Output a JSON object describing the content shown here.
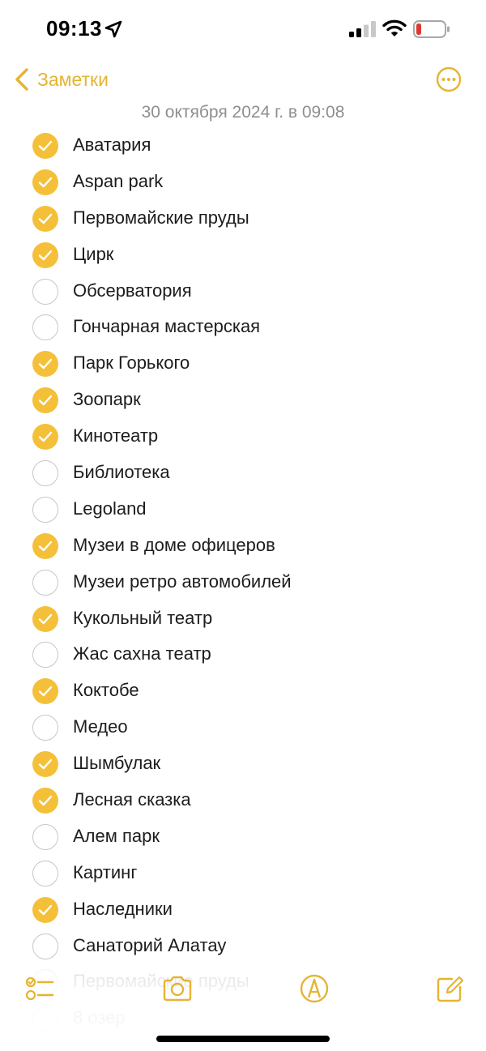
{
  "status_bar": {
    "time": "09:13",
    "icons": [
      "location-arrow-icon",
      "cellular-signal-icon",
      "wifi-icon",
      "battery-low-icon"
    ],
    "battery_color": "#e0382f"
  },
  "nav": {
    "back_label": "Заметки",
    "back_icon": "chevron-left-icon",
    "more_icon": "ellipsis-circle-icon"
  },
  "note": {
    "date": "30 октября 2024 г. в 09:08"
  },
  "accent_color": "#F5C039",
  "checklist": [
    {
      "label": "Аватария",
      "checked": true
    },
    {
      "label": "Aspan park",
      "checked": true
    },
    {
      "label": "Первомайские пруды",
      "checked": true
    },
    {
      "label": "Цирк",
      "checked": true
    },
    {
      "label": "Обсерватория",
      "checked": false
    },
    {
      "label": "Гончарная мастерская",
      "checked": false
    },
    {
      "label": "Парк Горького",
      "checked": true
    },
    {
      "label": "Зоопарк",
      "checked": true
    },
    {
      "label": "Кинотеатр",
      "checked": true
    },
    {
      "label": "Библиотека",
      "checked": false
    },
    {
      "label": "Legoland",
      "checked": false
    },
    {
      "label": "Музеи в доме офицеров",
      "checked": true
    },
    {
      "label": "Музеи ретро автомобилей",
      "checked": false
    },
    {
      "label": "Кукольный театр",
      "checked": true
    },
    {
      "label": "Жас сахна театр",
      "checked": false
    },
    {
      "label": "Коктобе",
      "checked": true
    },
    {
      "label": "Медео",
      "checked": false
    },
    {
      "label": "Шымбулак",
      "checked": true
    },
    {
      "label": "Лесная сказка",
      "checked": true
    },
    {
      "label": "Алем парк",
      "checked": false
    },
    {
      "label": "Картинг",
      "checked": false
    },
    {
      "label": "Наследники",
      "checked": true
    },
    {
      "label": "Санаторий Алатау",
      "checked": false
    },
    {
      "label": "Первомайские пруды",
      "checked": false
    },
    {
      "label": "8 озер",
      "checked": false
    }
  ],
  "toolbar": {
    "items": [
      "checklist-icon",
      "camera-icon",
      "markup-pen-icon",
      "compose-icon"
    ]
  }
}
